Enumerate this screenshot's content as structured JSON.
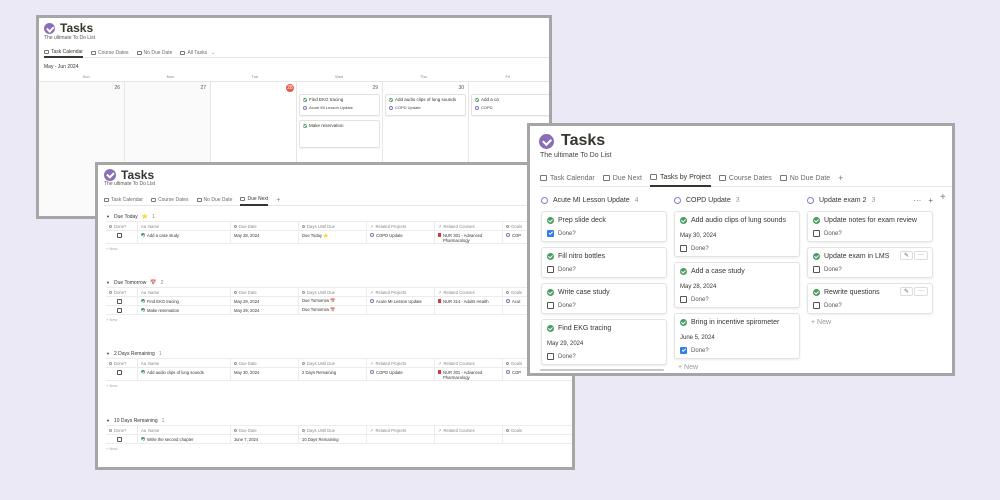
{
  "calendar_window": {
    "title": "Tasks",
    "subtitle": "The ultimate To Do List",
    "tabs": [
      "Task Calendar",
      "Course Dates",
      "No Due Date",
      "All Tasks"
    ],
    "month": "May - Jun 2024",
    "days": [
      "Sun",
      "Mon",
      "Tue",
      "Wed",
      "Thu",
      "Fri"
    ],
    "dates": [
      "26",
      "27",
      "28",
      "29",
      "30"
    ],
    "cards": [
      {
        "title": "Find EKG tracing",
        "project": "Acute MI Lesson Update"
      },
      {
        "title": "Make reservation"
      },
      {
        "title": "Add audio clips of lung sounds",
        "project": "COPD Update"
      },
      {
        "title": "Add a ca",
        "project": "COPD"
      }
    ]
  },
  "table_window": {
    "title": "Tasks",
    "subtitle": "The ultimate To Do List",
    "tabs": [
      "Task Calendar",
      "Course Dates",
      "No Due Date",
      "Due Next"
    ],
    "columns": [
      "Done?",
      "Name",
      "Due Date",
      "Days Until Due",
      "Related Projects",
      "Related Courses",
      "Goals"
    ],
    "new_label": "+ New",
    "groups": [
      {
        "label": "Due Today",
        "emoji": "⭐",
        "count": "1",
        "rows": [
          {
            "name": "Add a case study",
            "due": "May 28, 2024",
            "days": "Due Today ⭐",
            "project": "COPD Update",
            "course": "NUR 301 - Advanced Pharmacology",
            "goal": "COP"
          }
        ]
      },
      {
        "label": "Due Tomorrow",
        "emoji": "📅",
        "count": "2",
        "rows": [
          {
            "name": "Find EKG tracing",
            "due": "May 29, 2024",
            "days": "Due Tomorrow 📅",
            "project": "Acute MI Lesson Update",
            "course": "NUR 314 - Adults Health",
            "goal": "Acut"
          },
          {
            "name": "Make reservation",
            "due": "May 29, 2024",
            "days": "Due Tomorrow 📅",
            "project": "",
            "course": "",
            "goal": ""
          }
        ]
      },
      {
        "label": "2 Days Remaining",
        "emoji": "",
        "count": "1",
        "rows": [
          {
            "name": "Add audio clips of lung sounds",
            "due": "May 30, 2024",
            "days": "2 Days Remaining",
            "project": "COPD Update",
            "course": "NUR 301 - Advanced Pharmacology",
            "goal": "COP"
          }
        ]
      },
      {
        "label": "10 Days Remaining",
        "emoji": "",
        "count": "1",
        "rows": [
          {
            "name": "Write the second chapter",
            "due": "June 7, 2024",
            "days": "10 Days Remaining",
            "project": "",
            "course": "",
            "goal": ""
          }
        ]
      }
    ]
  },
  "board_window": {
    "title": "Tasks",
    "subtitle": "The ultimate To Do List",
    "tabs": [
      "Task Calendar",
      "Due Next",
      "Tasks by Project",
      "Course Dates",
      "No Due Date"
    ],
    "done_label": "Done?",
    "new_label": "+ New",
    "columns": [
      {
        "name": "Acute MI Lesson Update",
        "count": "4",
        "cards": [
          {
            "title": "Prep slide deck",
            "date": "",
            "done": true
          },
          {
            "title": "Fill nitro bottles",
            "date": "",
            "done": false
          },
          {
            "title": "Write case study",
            "date": "",
            "done": false
          },
          {
            "title": "Find EKG tracing",
            "date": "May 29, 2024",
            "done": false
          }
        ]
      },
      {
        "name": "COPD Update",
        "count": "3",
        "cards": [
          {
            "title": "Add audio clips of lung sounds",
            "date": "May 30, 2024",
            "done": false
          },
          {
            "title": "Add a case study",
            "date": "May 28, 2024",
            "done": false
          },
          {
            "title": "Bring in incentive spirometer",
            "date": "June 5, 2024",
            "done": true
          }
        ]
      },
      {
        "name": "Update exam 2",
        "count": "3",
        "cards": [
          {
            "title": "Update notes for exam review",
            "date": "",
            "done": false
          },
          {
            "title": "Update exam in LMS",
            "date": "",
            "done": false
          },
          {
            "title": "Rewrite questions",
            "date": "",
            "done": false
          }
        ]
      }
    ]
  },
  "colors": {
    "background": "#ece9f6",
    "window_border": "#a6a6a6",
    "accent_purple": "#8a6fb8",
    "task_green": "#4a9b63",
    "today_red": "#e35a4a",
    "checkbox_blue": "#2f80ed"
  },
  "icons": [
    "check-circle-icon",
    "calendar-icon",
    "table-icon",
    "board-icon",
    "task-check-icon",
    "project-ring-icon",
    "course-book-icon",
    "plus-icon",
    "more-icon",
    "edit-icon"
  ]
}
